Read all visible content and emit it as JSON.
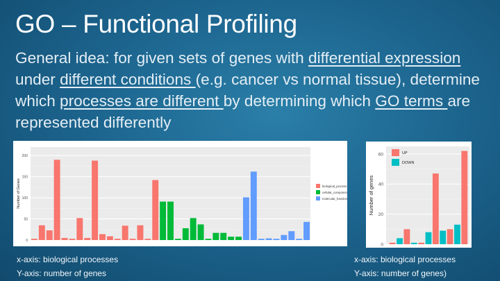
{
  "slide": {
    "title": "GO – Functional Profiling",
    "body_parts": [
      {
        "text": "General idea: for given sets of genes with ",
        "u": false
      },
      {
        "text": "differential expression",
        "u": true
      },
      {
        "text": " under ",
        "u": false
      },
      {
        "text": "different conditions ",
        "u": true
      },
      {
        "text": "(e.g. cancer vs normal tissue), determine which ",
        "u": false
      },
      {
        "text": "processes are different ",
        "u": true
      },
      {
        "text": "by determining which ",
        "u": false
      },
      {
        "text": "GO terms ",
        "u": true
      },
      {
        "text": "are represented differently",
        "u": false
      }
    ],
    "caption_left": {
      "x": "x-axis: biological processes",
      "y": "Y-axis: number of genes"
    },
    "caption_right": {
      "x": "x-axis: biological processes",
      "y": "Y-axis: number of genes)"
    }
  },
  "chart_data": [
    {
      "type": "bar",
      "title": "",
      "xlabel": "",
      "ylabel": "Number of Genes",
      "ylim": [
        0,
        220
      ],
      "yticks": [
        0,
        50,
        100,
        150,
        200
      ],
      "grid": true,
      "legend_position": "right",
      "legend": [
        {
          "name": "biological_process",
          "color": "#f8766d"
        },
        {
          "name": "cellular_component",
          "color": "#00ba38"
        },
        {
          "name": "molecular_function",
          "color": "#619cff"
        }
      ],
      "bars": [
        {
          "v": 3,
          "c": 0
        },
        {
          "v": 35,
          "c": 0
        },
        {
          "v": 23,
          "c": 0
        },
        {
          "v": 190,
          "c": 0
        },
        {
          "v": 5,
          "c": 0
        },
        {
          "v": 3,
          "c": 0
        },
        {
          "v": 52,
          "c": 0
        },
        {
          "v": 5,
          "c": 0
        },
        {
          "v": 188,
          "c": 0
        },
        {
          "v": 14,
          "c": 0
        },
        {
          "v": 9,
          "c": 0
        },
        {
          "v": 3,
          "c": 0
        },
        {
          "v": 34,
          "c": 0
        },
        {
          "v": 3,
          "c": 0
        },
        {
          "v": 35,
          "c": 0
        },
        {
          "v": 3,
          "c": 0
        },
        {
          "v": 142,
          "c": 0
        },
        {
          "v": 91,
          "c": 1
        },
        {
          "v": 91,
          "c": 1
        },
        {
          "v": 3,
          "c": 1
        },
        {
          "v": 28,
          "c": 1
        },
        {
          "v": 52,
          "c": 1
        },
        {
          "v": 37,
          "c": 1
        },
        {
          "v": 3,
          "c": 1
        },
        {
          "v": 17,
          "c": 1
        },
        {
          "v": 17,
          "c": 1
        },
        {
          "v": 8,
          "c": 1
        },
        {
          "v": 8,
          "c": 1
        },
        {
          "v": 101,
          "c": 2
        },
        {
          "v": 162,
          "c": 2
        },
        {
          "v": 3,
          "c": 2
        },
        {
          "v": 4,
          "c": 2
        },
        {
          "v": 3,
          "c": 2
        },
        {
          "v": 12,
          "c": 2
        },
        {
          "v": 21,
          "c": 2
        },
        {
          "v": 3,
          "c": 2
        },
        {
          "v": 43,
          "c": 2
        }
      ]
    },
    {
      "type": "bar",
      "title": "",
      "xlabel": "",
      "ylabel": "Number of genes",
      "ylim": [
        0,
        65
      ],
      "yticks": [
        0,
        20,
        40,
        60
      ],
      "grid": true,
      "legend_position": "top-left",
      "series": [
        {
          "name": "UP",
          "color": "#f8766d",
          "values": [
            1,
            10,
            1,
            47,
            10,
            62
          ]
        },
        {
          "name": "DOWN",
          "color": "#00bfc4",
          "values": [
            4,
            1,
            8,
            9,
            13,
            0
          ]
        }
      ],
      "pair_order": [
        [
          "UP",
          1
        ],
        [
          "DOWN",
          4
        ],
        [
          "UP",
          10
        ],
        [
          "DOWN",
          1
        ],
        [
          "UP",
          1
        ],
        [
          "DOWN",
          8
        ],
        [
          "UP",
          47
        ],
        [
          "DOWN",
          9
        ],
        [
          "UP",
          10
        ],
        [
          "DOWN",
          13
        ],
        [
          "UP",
          62
        ]
      ]
    }
  ]
}
